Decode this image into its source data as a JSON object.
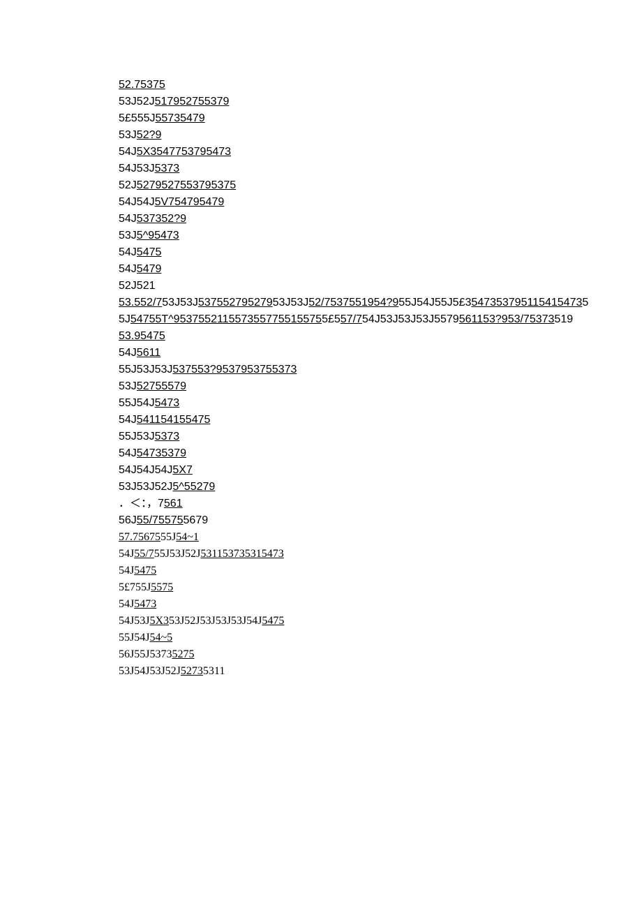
{
  "segments": [
    {
      "t": "52.75375",
      "u": true
    },
    {
      "t": "\n"
    },
    {
      "t": "53J52J"
    },
    {
      "t": "517952755379",
      "u": true
    },
    {
      "t": "\n"
    },
    {
      "t": "5£555J"
    },
    {
      "t": "55735479",
      "u": true
    },
    {
      "t": "\n"
    },
    {
      "t": "53J"
    },
    {
      "t": "52?9",
      "u": true
    },
    {
      "t": "\n"
    },
    {
      "t": "54J"
    },
    {
      "t": "5X3547753795473",
      "u": true
    },
    {
      "t": "\n"
    },
    {
      "t": "54J53J"
    },
    {
      "t": "5373",
      "u": true
    },
    {
      "t": "\n"
    },
    {
      "t": "52J"
    },
    {
      "t": "5279527553795375",
      "u": true
    },
    {
      "t": "\n"
    },
    {
      "t": "54J54J"
    },
    {
      "t": "5V754795479",
      "u": true
    },
    {
      "t": "\n"
    },
    {
      "t": "54J"
    },
    {
      "t": "537352?9",
      "u": true
    },
    {
      "t": "\n"
    },
    {
      "t": "53J"
    },
    {
      "t": "5^95473",
      "u": true
    },
    {
      "t": "\n"
    },
    {
      "t": "54J"
    },
    {
      "t": "5475",
      "u": true
    },
    {
      "t": "\n"
    },
    {
      "t": "54J"
    },
    {
      "t": "5479",
      "u": true
    },
    {
      "t": "\n"
    },
    {
      "t": "52J521"
    },
    {
      "t": "\n"
    },
    {
      "t": "53.552/7",
      "u": true
    },
    {
      "t": "53J53J"
    },
    {
      "t": "537552795279",
      "u": true
    },
    {
      "t": "53J53J"
    },
    {
      "t": "52/7537551954?9",
      "u": true
    },
    {
      "t": "55J54J55J5£3"
    },
    {
      "t": "547353795115415473",
      "u": true
    },
    {
      "t": "55J"
    },
    {
      "t": "54755T^953755211557355775515575",
      "u": true
    },
    {
      "t": "5£5"
    },
    {
      "t": "57/7",
      "u": true
    },
    {
      "t": "54J53J53J53J5579"
    },
    {
      "t": "561153?953/75373",
      "u": true
    },
    {
      "t": "519"
    },
    {
      "t": "\n"
    },
    {
      "t": "53.95475",
      "u": true
    },
    {
      "t": "\n"
    },
    {
      "t": "54J"
    },
    {
      "t": "5611",
      "u": true
    },
    {
      "t": "\n"
    },
    {
      "t": "55J53J53J"
    },
    {
      "t": "537553?9537953755373",
      "u": true
    },
    {
      "t": "\n"
    },
    {
      "t": "53J"
    },
    {
      "t": "52755579",
      "u": true
    },
    {
      "t": "\n"
    },
    {
      "t": "55J54J"
    },
    {
      "t": "5473",
      "u": true
    },
    {
      "t": "\n"
    },
    {
      "t": "54J"
    },
    {
      "t": "541154155475",
      "u": true
    },
    {
      "t": "\n"
    },
    {
      "t": "55J53J"
    },
    {
      "t": "5373",
      "u": true
    },
    {
      "t": "\n"
    },
    {
      "t": "54J"
    },
    {
      "t": "54735379",
      "u": true
    },
    {
      "t": "\n"
    },
    {
      "t": "54J54J54J"
    },
    {
      "t": "5X7",
      "u": true
    },
    {
      "t": "\n"
    },
    {
      "t": "53J53J52J"
    },
    {
      "t": "5^55279",
      "u": true
    },
    {
      "t": "\n"
    },
    {
      "t": "．＜：，7"
    },
    {
      "t": "561",
      "u": true
    },
    {
      "t": "\n"
    },
    {
      "t": "56J"
    },
    {
      "t": "55/75575",
      "u": true
    },
    {
      "t": "5679"
    },
    {
      "t": "\n"
    },
    {
      "t": "57.75675",
      "u": true,
      "ser": true
    },
    {
      "t": "55J",
      "ser": true
    },
    {
      "t": "54~1",
      "u": true,
      "ser": true
    },
    {
      "t": "\n"
    },
    {
      "t": "54J",
      "ser": true
    },
    {
      "t": "55/7",
      "u": true,
      "ser": true
    },
    {
      "t": "55J53J52J",
      "ser": true
    },
    {
      "t": "531153735315473",
      "u": true,
      "ser": true
    },
    {
      "t": "\n"
    },
    {
      "t": "54J",
      "ser": true
    },
    {
      "t": "5475",
      "u": true,
      "ser": true
    },
    {
      "t": "\n"
    },
    {
      "t": "5£755J",
      "ser": true
    },
    {
      "t": "5575",
      "u": true,
      "ser": true
    },
    {
      "t": "\n"
    },
    {
      "t": "54J",
      "ser": true
    },
    {
      "t": "5473",
      "u": true,
      "ser": true
    },
    {
      "t": "\n"
    },
    {
      "t": "54J53J",
      "ser": true
    },
    {
      "t": "5X3",
      "u": true,
      "ser": true
    },
    {
      "t": "53J52J53J53J53J54J",
      "ser": true
    },
    {
      "t": "5475",
      "u": true,
      "ser": true
    },
    {
      "t": "\n"
    },
    {
      "t": "55J54J",
      "ser": true
    },
    {
      "t": "54~5",
      "u": true,
      "ser": true
    },
    {
      "t": "\n"
    },
    {
      "t": "56J55J5373",
      "ser": true
    },
    {
      "t": "5275",
      "u": true,
      "ser": true
    },
    {
      "t": "\n"
    },
    {
      "t": "53J54J53J52J",
      "ser": true
    },
    {
      "t": "5273",
      "u": true,
      "ser": true
    },
    {
      "t": "5311",
      "ser": true
    },
    {
      "t": "\n"
    }
  ]
}
